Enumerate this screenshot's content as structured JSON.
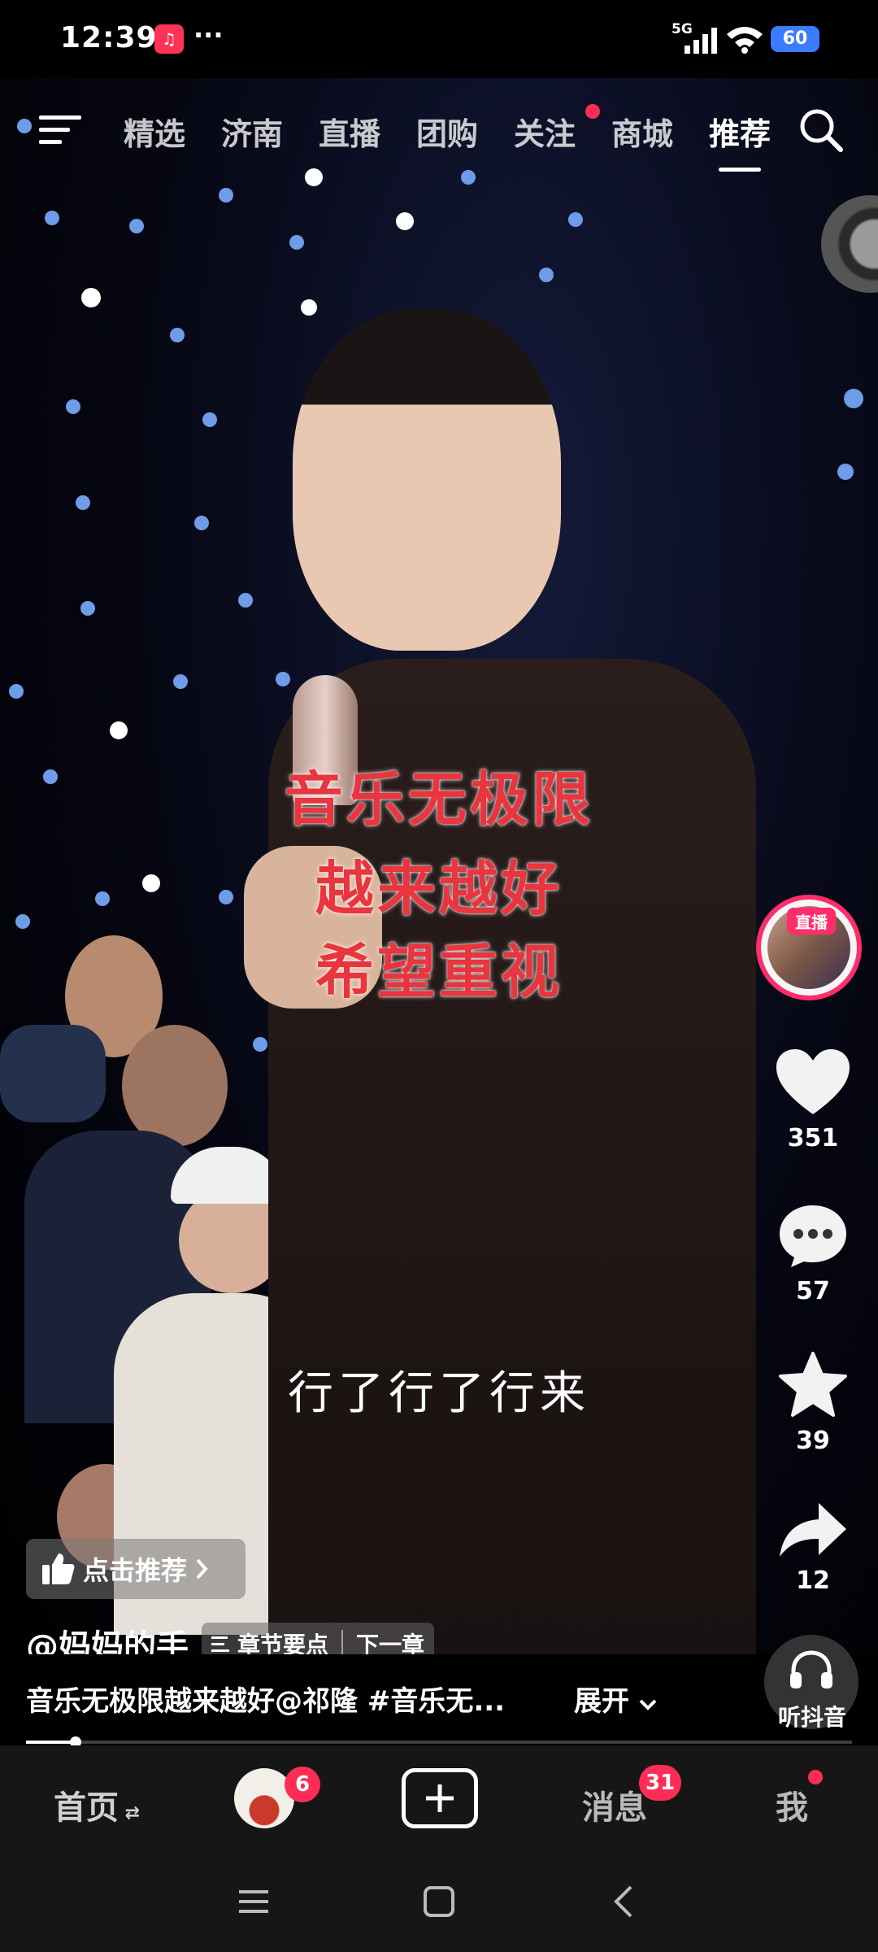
{
  "status_bar": {
    "time": "12:39",
    "more": "···",
    "network": "5G",
    "battery": "60"
  },
  "top_nav": {
    "tabs": [
      {
        "label": "精选",
        "active": false
      },
      {
        "label": "济南",
        "active": false
      },
      {
        "label": "直播",
        "active": false
      },
      {
        "label": "团购",
        "active": false
      },
      {
        "label": "关注",
        "active": false,
        "dot": true
      },
      {
        "label": "商城",
        "active": false
      },
      {
        "label": "推荐",
        "active": true
      }
    ]
  },
  "video": {
    "captions": [
      "音乐无极限",
      "越来越好",
      "希望重视"
    ],
    "subtitle": "行了行了行来"
  },
  "right_rail": {
    "live_label": "直播",
    "likes": "351",
    "comments": "57",
    "favorites": "39",
    "shares": "12",
    "listen_label": "听抖音"
  },
  "info": {
    "recommend_label": "点击推荐",
    "author": "@妈妈的手",
    "chapter_points": "章节要点",
    "next_chapter": "下一章",
    "description": "音乐无极限越来越好@祁隆 #音乐无...",
    "expand": "展开",
    "progress": 0.06
  },
  "tab_bar": {
    "home": "首页",
    "friends_badge": "6",
    "messages": "消息",
    "messages_badge": "31",
    "me": "我"
  },
  "colors": {
    "accent": "#ff2d55",
    "caption_red": "#e8353e",
    "battery": "#3a7bff"
  }
}
